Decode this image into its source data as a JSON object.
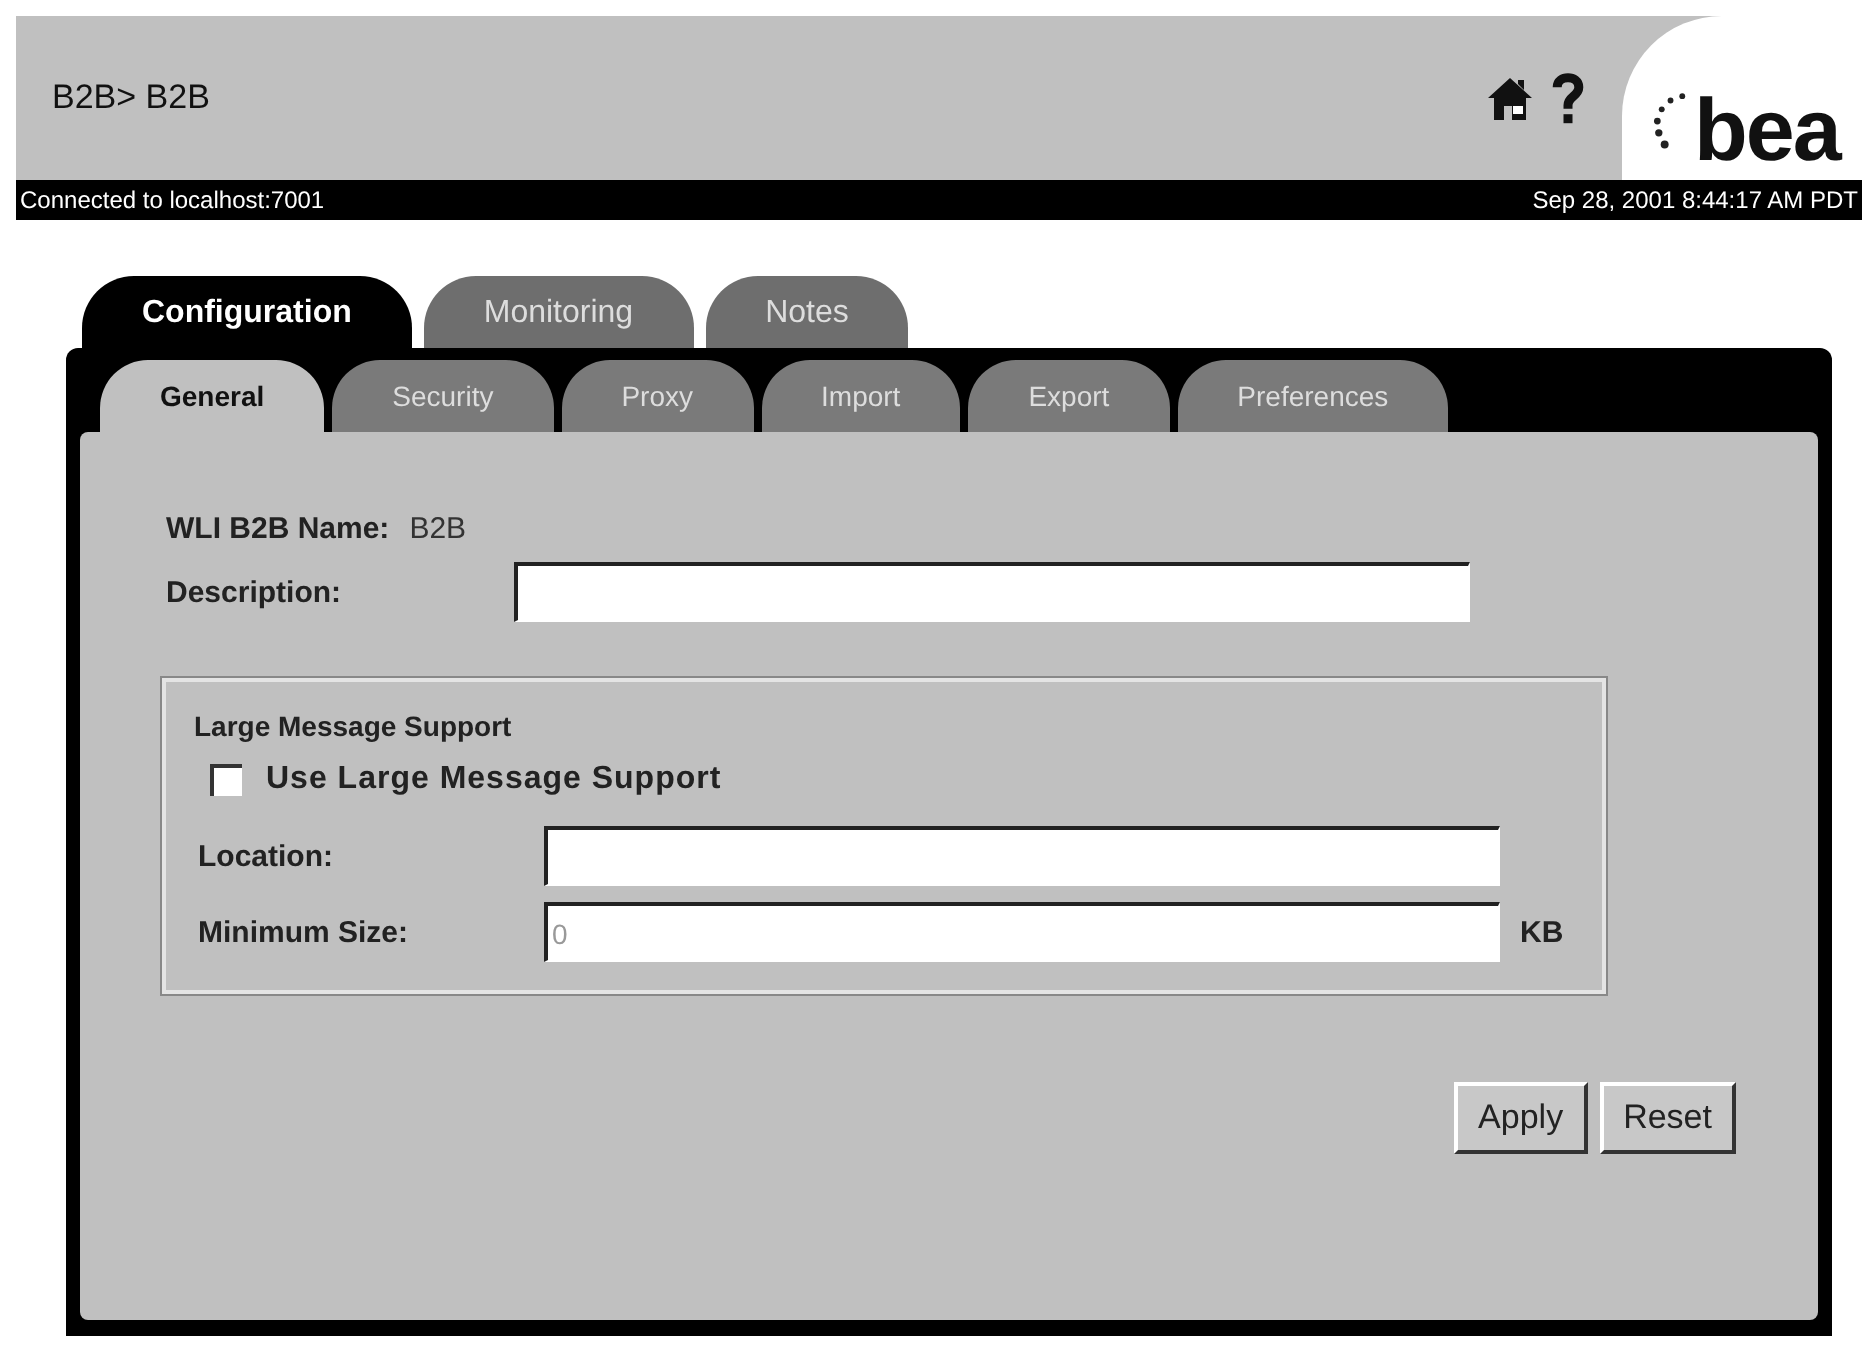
{
  "header": {
    "breadcrumb": "B2B> B2B",
    "logo_text": "bea"
  },
  "status_bar": {
    "connection": "Connected to localhost:7001",
    "timestamp": "Sep 28, 2001 8:44:17 AM PDT"
  },
  "tabs": [
    {
      "label": "Configuration",
      "selected": true
    },
    {
      "label": "Monitoring",
      "selected": false
    },
    {
      "label": "Notes",
      "selected": false
    }
  ],
  "subtabs": [
    {
      "label": "General",
      "selected": true
    },
    {
      "label": "Security",
      "selected": false
    },
    {
      "label": "Proxy",
      "selected": false
    },
    {
      "label": "Import",
      "selected": false
    },
    {
      "label": "Export",
      "selected": false
    },
    {
      "label": "Preferences",
      "selected": false
    }
  ],
  "form": {
    "name_label": "WLI B2B Name:",
    "name_value": "B2B",
    "description_label": "Description:",
    "group": {
      "title": "Large Message Support",
      "checkbox": {
        "label": "Use Large Message Support",
        "checked": false
      },
      "location_label": "Location:",
      "min_size_label": "Minimum Size:",
      "min_size_placeholder": "0",
      "unit": "KB"
    }
  },
  "buttons": [
    "Apply",
    "Reset"
  ]
}
